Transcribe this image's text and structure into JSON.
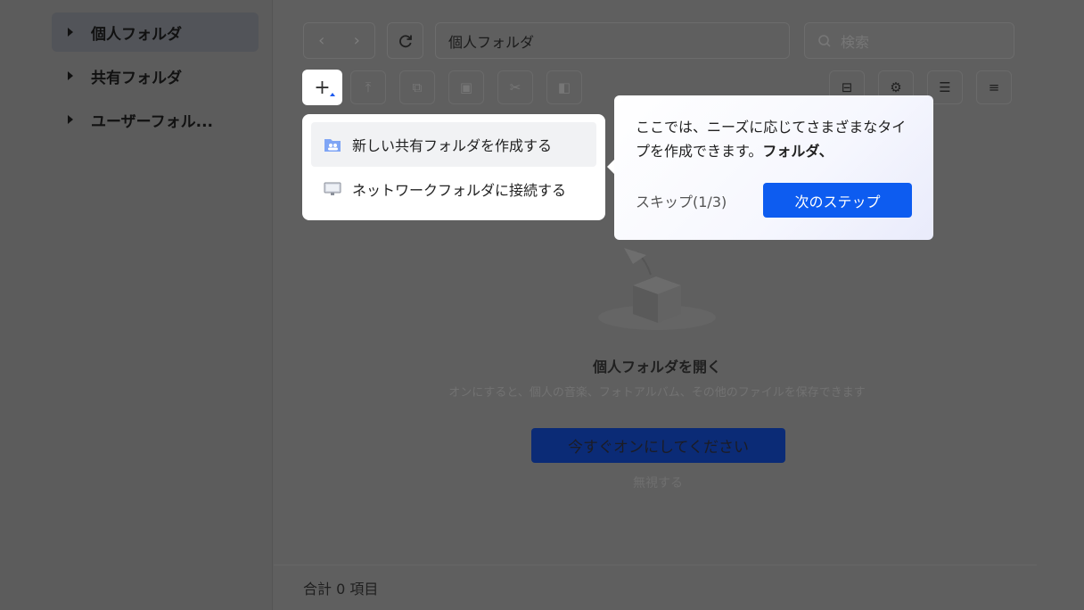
{
  "sidebar": {
    "items": [
      {
        "label": "個人フォルダ",
        "active": true
      },
      {
        "label": "共有フォルダ",
        "active": false
      },
      {
        "label": "ユーザーフォル..."
      }
    ]
  },
  "toolbar": {
    "path": "個人フォルダ",
    "search_placeholder": "検索",
    "add_label": "+"
  },
  "dropdown": {
    "items": [
      {
        "label": "新しい共有フォルダを作成する",
        "icon": "shared-folder-icon"
      },
      {
        "label": "ネットワークフォルダに接続する",
        "icon": "monitor-icon"
      }
    ]
  },
  "tooltip": {
    "text": "ここでは、ニーズに応じてさまざまなタイプを作成できます。",
    "bold": "フォルダ、",
    "skip": "スキップ(1/3)",
    "next": "次のステップ"
  },
  "empty_state": {
    "title": "個人フォルダを開く",
    "description": "オンにすると、個人の音楽、フォトアルバム、その他のファイルを保存できます",
    "button": "今すぐオンにしてください",
    "ignore": "無視する"
  },
  "footer": {
    "total": "合計 0 項目"
  },
  "colors": {
    "accent": "#0d5cf0",
    "overlay": "#5e5e5e"
  }
}
